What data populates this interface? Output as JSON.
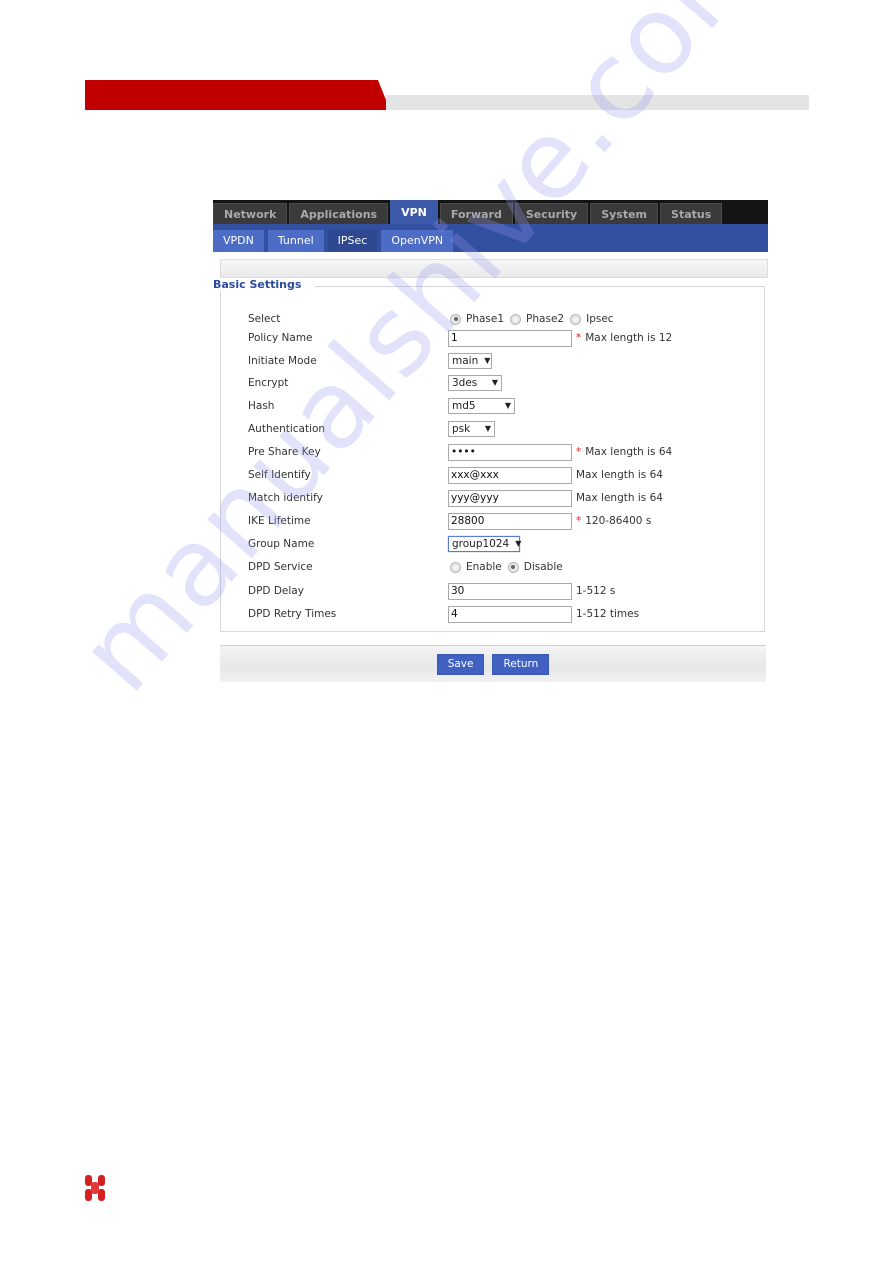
{
  "top_nav": {
    "tabs": [
      {
        "label": "Network",
        "active": false
      },
      {
        "label": "Applications",
        "active": false
      },
      {
        "label": "VPN",
        "active": true
      },
      {
        "label": "Forward",
        "active": false
      },
      {
        "label": "Security",
        "active": false
      },
      {
        "label": "System",
        "active": false
      },
      {
        "label": "Status",
        "active": false
      }
    ]
  },
  "sub_nav": {
    "tabs": [
      {
        "label": "VPDN",
        "active": false
      },
      {
        "label": "Tunnel",
        "active": false
      },
      {
        "label": "IPSec",
        "active": true
      },
      {
        "label": "OpenVPN",
        "active": false
      }
    ]
  },
  "basic_settings": {
    "title": "Basic Settings",
    "select": {
      "label": "Select",
      "options": [
        "Phase1",
        "Phase2",
        "Ipsec"
      ],
      "selected": "Phase1"
    },
    "policy_name": {
      "label": "Policy Name",
      "value": "1",
      "required": "*",
      "hint": "Max length is 12"
    },
    "initiate_mode": {
      "label": "Initiate Mode",
      "value": "main"
    },
    "encrypt": {
      "label": "Encrypt",
      "value": "3des"
    },
    "hash": {
      "label": "Hash",
      "value": "md5"
    },
    "authentication": {
      "label": "Authentication",
      "value": "psk"
    },
    "pre_share_key": {
      "label": "Pre Share Key",
      "value": "••••",
      "required": "*",
      "hint": "Max length is 64"
    },
    "self_identify": {
      "label": "Self Identify",
      "value": "xxx@xxx",
      "hint": "Max length is 64"
    },
    "match_identify": {
      "label": "Match identify",
      "value": "yyy@yyy",
      "hint": "Max length is 64"
    },
    "ike_lifetime": {
      "label": "IKE Lifetime",
      "value": "28800",
      "required": "*",
      "hint": "120-86400 s"
    },
    "group_name": {
      "label": "Group Name",
      "value": "group1024"
    },
    "dpd_service": {
      "label": "DPD Service",
      "options": [
        "Enable",
        "Disable"
      ],
      "selected": "Disable"
    },
    "dpd_delay": {
      "label": "DPD Delay",
      "value": "30",
      "hint": "1-512 s"
    },
    "dpd_retry_times": {
      "label": "DPD Retry Times",
      "value": "4",
      "hint": "1-512 times"
    }
  },
  "actions": {
    "save": "Save",
    "return": "Return"
  },
  "icons": {
    "dropdown": "▼"
  },
  "watermark": "manualshive.com",
  "colors": {
    "brand_red": "#c00000",
    "nav_blue": "#3350a0",
    "button_blue": "#4161c2",
    "required_red": "#dd2222"
  }
}
